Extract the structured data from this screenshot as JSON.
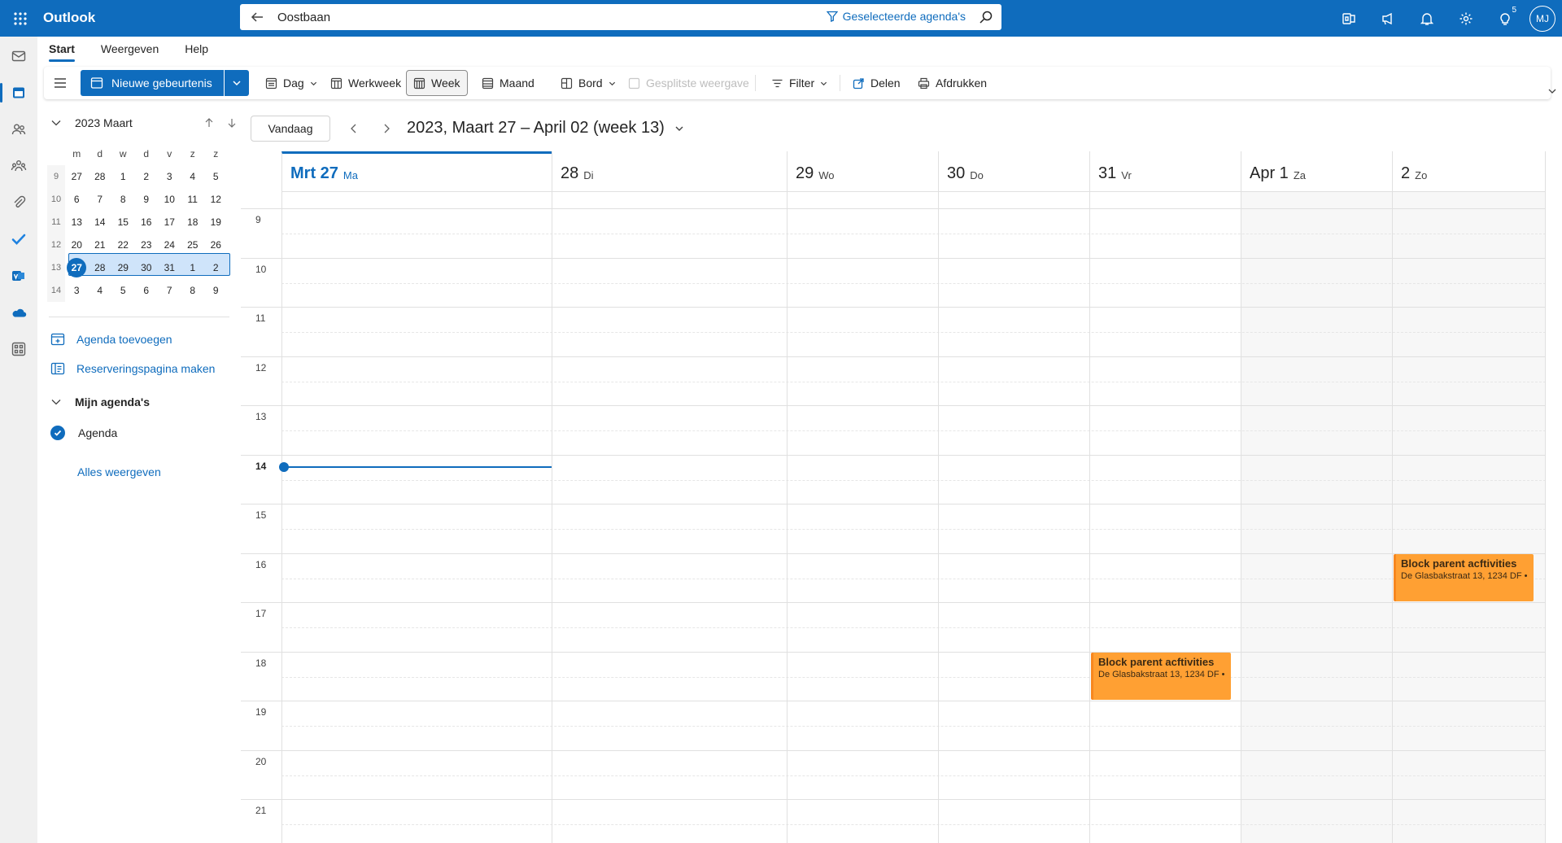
{
  "app": {
    "name": "Outlook"
  },
  "search": {
    "value": "Oostbaan",
    "scope_label": "Geselecteerde agenda's"
  },
  "header": {
    "tips_badge": "5",
    "avatar_initials": "MJ"
  },
  "ribbon": {
    "tabs": [
      "Start",
      "Weergeven",
      "Help"
    ],
    "active_tab": "Start",
    "new_event_label": "Nieuwe gebeurtenis",
    "buttons": {
      "day": "Dag",
      "workweek": "Werkweek",
      "week": "Week",
      "month": "Maand",
      "board": "Bord",
      "split": "Gesplitste weergave",
      "filter": "Filter",
      "share": "Delen",
      "print": "Afdrukken"
    },
    "selected_view": "Week"
  },
  "mini_calendar": {
    "title": "2023 Maart",
    "weekday_headers": [
      "m",
      "d",
      "w",
      "d",
      "v",
      "z",
      "z"
    ],
    "weeks": [
      {
        "week": "9",
        "days": [
          "27",
          "28",
          "1",
          "2",
          "3",
          "4",
          "5"
        ]
      },
      {
        "week": "10",
        "days": [
          "6",
          "7",
          "8",
          "9",
          "10",
          "11",
          "12"
        ]
      },
      {
        "week": "11",
        "days": [
          "13",
          "14",
          "15",
          "16",
          "17",
          "18",
          "19"
        ]
      },
      {
        "week": "12",
        "days": [
          "20",
          "21",
          "22",
          "23",
          "24",
          "25",
          "26"
        ]
      },
      {
        "week": "13",
        "days": [
          "27",
          "28",
          "29",
          "30",
          "31",
          "1",
          "2"
        ]
      },
      {
        "week": "14",
        "days": [
          "3",
          "4",
          "5",
          "6",
          "7",
          "8",
          "9"
        ]
      }
    ],
    "today": "27"
  },
  "left_pane": {
    "add_calendar": "Agenda toevoegen",
    "booking_page": "Reserveringspagina maken",
    "my_calendars": "Mijn agenda's",
    "calendar_name": "Agenda",
    "show_all": "Alles weergeven"
  },
  "calendar": {
    "today_button": "Vandaag",
    "range_title": "2023, Maart 27 – April 02 (week 13)",
    "days": [
      {
        "num": "Mrt 27",
        "dow": "Ma"
      },
      {
        "num": "28",
        "dow": "Di"
      },
      {
        "num": "29",
        "dow": "Wo"
      },
      {
        "num": "30",
        "dow": "Do"
      },
      {
        "num": "31",
        "dow": "Vr"
      },
      {
        "num": "Apr 1",
        "dow": "Za"
      },
      {
        "num": "2",
        "dow": "Zo"
      }
    ],
    "hours": [
      "9",
      "10",
      "11",
      "12",
      "13",
      "14",
      "15",
      "16",
      "17",
      "18",
      "19",
      "20",
      "21"
    ],
    "current_hour": "14",
    "events": [
      {
        "title": "Block parent acftivities",
        "location": "De Glasbakstraat 13, 1234 DF •",
        "day": "2",
        "start": "16:00",
        "end": "17:00"
      },
      {
        "title": "Block parent acftivities",
        "location": "De Glasbakstraat 13, 1234 DF •",
        "day": "31",
        "start": "18:00",
        "end": "19:00"
      }
    ]
  },
  "colors": {
    "accent": "#0f6cbd",
    "event": "#ffa033"
  }
}
